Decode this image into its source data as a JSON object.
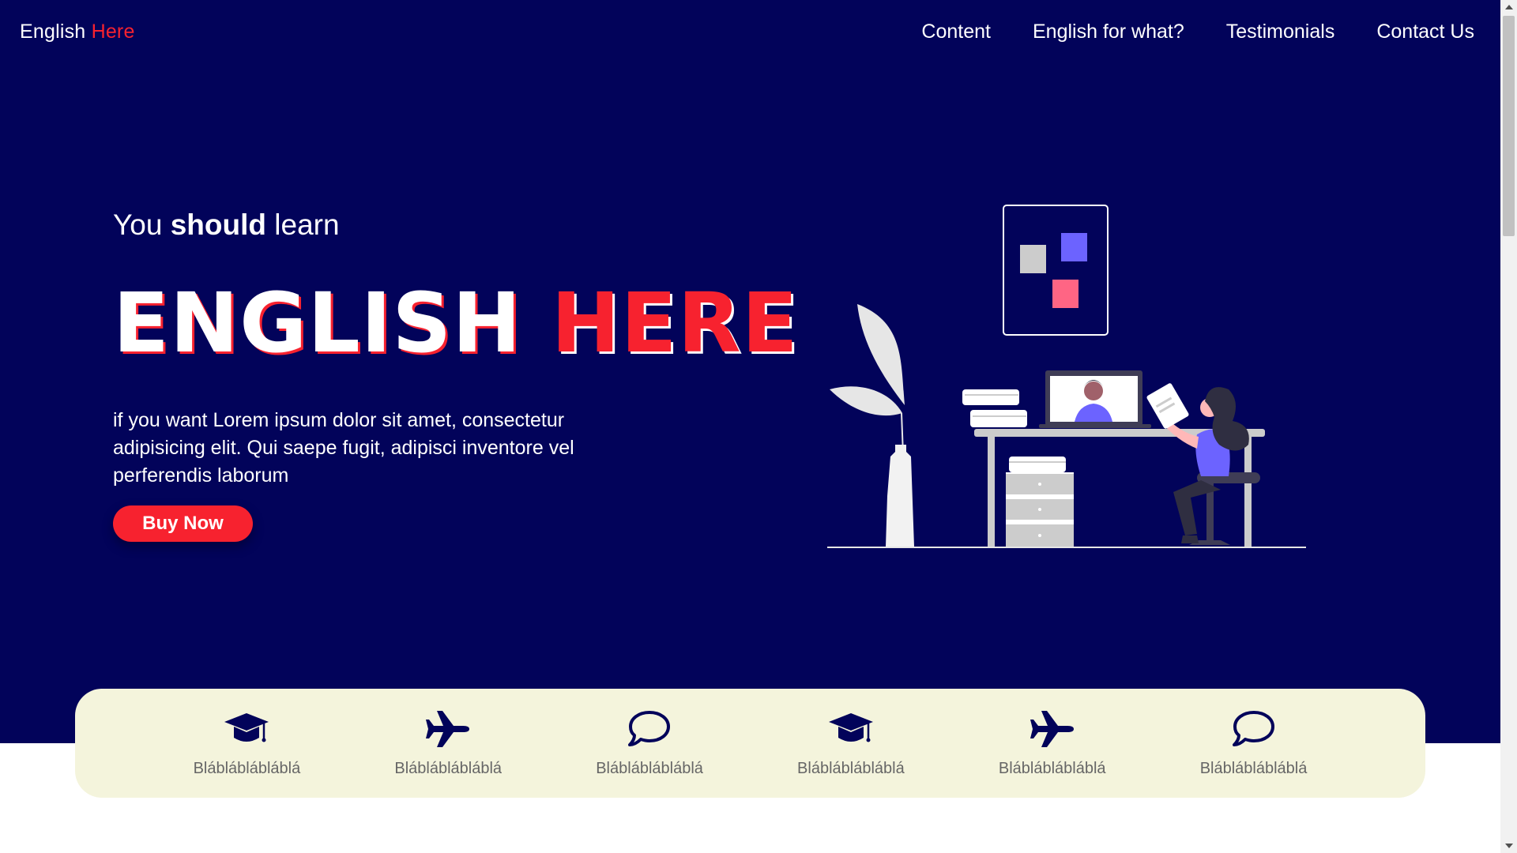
{
  "brand": {
    "name_part1": "English",
    "name_part2": "Here",
    "accent_color": "#f7222f"
  },
  "nav": {
    "items": [
      {
        "label": "Content"
      },
      {
        "label": "English for what?"
      },
      {
        "label": "Testimonials"
      },
      {
        "label": "Contact Us"
      }
    ]
  },
  "hero": {
    "eyebrow_part1": "You",
    "eyebrow_bold": "should",
    "eyebrow_part2": "learn",
    "headline_part1": "ENGLISH",
    "headline_part2": "HERE",
    "lead": "if you want Lorem ipsum dolor sit amet, consectetur adipisicing elit. Qui saepe fugit, adipisci inventore vel perferendis laborum",
    "cta_label": "Buy Now",
    "background_color": "#02035a"
  },
  "features": {
    "background_color": "#f4f4dc",
    "items": [
      {
        "icon": "graduation-cap-icon",
        "label": "Blábláblábláblá"
      },
      {
        "icon": "airplane-icon",
        "label": "Blábláblábláblá"
      },
      {
        "icon": "speech-bubble-icon",
        "label": "Blábláblábláblá"
      },
      {
        "icon": "graduation-cap-icon",
        "label": "Blábláblábláblá"
      },
      {
        "icon": "airplane-icon",
        "label": "Blábláblábláblá"
      },
      {
        "icon": "speech-bubble-icon",
        "label": "Blábláblábláblá"
      }
    ]
  }
}
